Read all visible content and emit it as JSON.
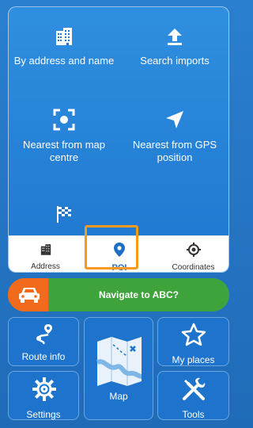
{
  "search_options": {
    "by_address": {
      "label": "By address and name",
      "icon": "building-icon"
    },
    "search_imports": {
      "label": "Search imports",
      "icon": "upload-icon"
    },
    "nearest_map": {
      "label": "Nearest from map centre",
      "icon": "focus-target-icon"
    },
    "nearest_gps": {
      "label": "Nearest from GPS position",
      "icon": "gps-arrow-icon"
    },
    "route_flag": {
      "label": "",
      "icon": "checkered-flag-icon"
    }
  },
  "tabs": [
    {
      "label": "Address",
      "icon": "building-icon",
      "active": false
    },
    {
      "label": "POI",
      "icon": "map-pin-icon",
      "active": true
    },
    {
      "label": "Coordinates",
      "icon": "crosshair-icon",
      "active": false
    }
  ],
  "navigate": {
    "label": "Navigate to ABC?",
    "icon": "car-icon"
  },
  "tiles": {
    "route_info": {
      "label": "Route info",
      "icon": "route-icon"
    },
    "map": {
      "label": "Map",
      "icon": "folded-map-icon"
    },
    "my_places": {
      "label": "My places",
      "icon": "star-icon"
    },
    "settings": {
      "label": "Settings",
      "icon": "gear-icon"
    },
    "tools": {
      "label": "Tools",
      "icon": "tools-icon"
    }
  },
  "colors": {
    "background": "#1f6bb8",
    "highlight": "#f59a20",
    "navigate_green": "#3fa33c",
    "navigate_orange": "#f26b1d",
    "active_tab": "#1f6fc6"
  }
}
